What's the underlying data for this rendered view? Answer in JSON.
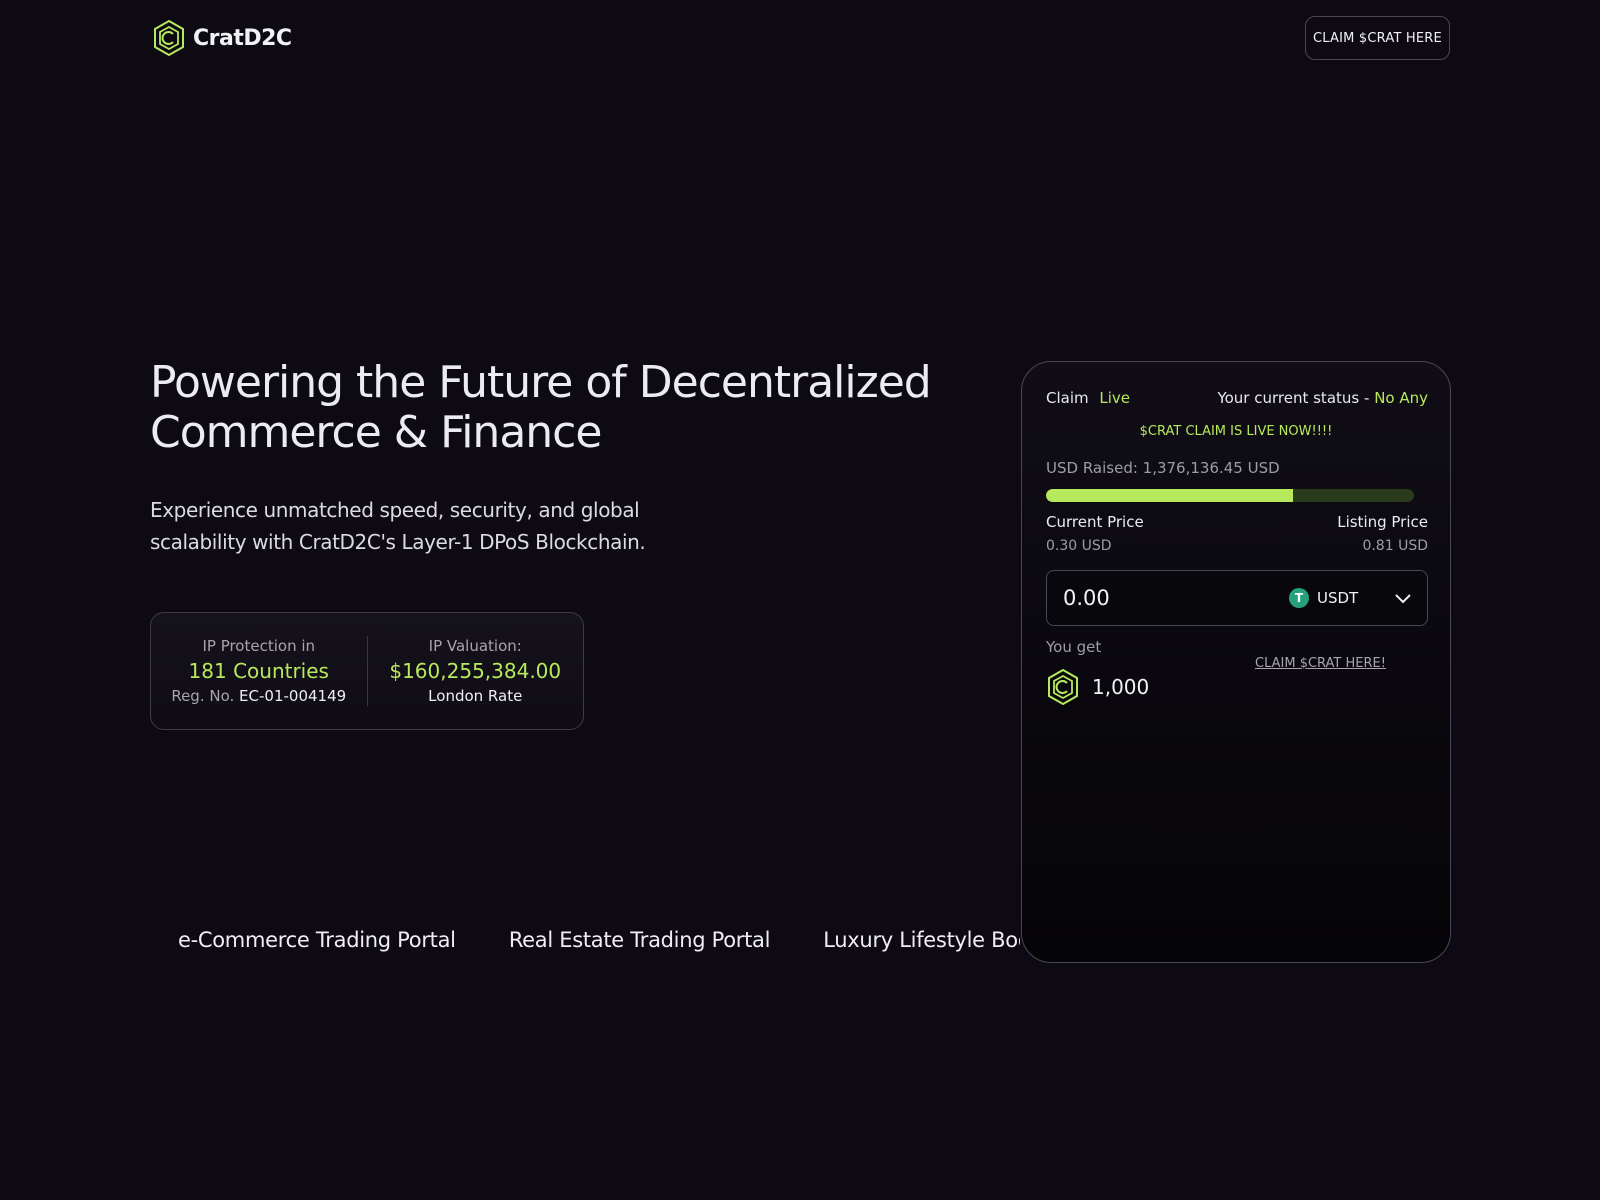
{
  "header": {
    "brand": "CratD2C",
    "claim_button": "CLAIM $CRAT HERE"
  },
  "hero": {
    "title_line1": "Powering the Future of Decentralized",
    "title_line2": "Commerce & Finance",
    "subtitle_line1": "Experience unmatched speed, security, and global",
    "subtitle_line2": "scalability with CratD2C's Layer-1 DPoS Blockchain."
  },
  "ip_card": {
    "protection_label": "IP Protection in",
    "protection_value": "181 Countries",
    "reg_prefix": "Reg. No.",
    "reg_number": "EC-01-004149",
    "valuation_label": "IP Valuation:",
    "valuation_value": "$160,255,384.00",
    "valuation_note": "London Rate"
  },
  "portals": [
    "e-Commerce Trading Portal",
    "Real Estate Trading Portal",
    "Luxury Lifestyle Book"
  ],
  "claim": {
    "label": "Claim",
    "status_live": "Live",
    "current_status_label": "Your current status -",
    "current_status_value": "No Any",
    "banner": "$CRAT CLAIM IS LIVE NOW!!!!",
    "usd_raised": "USD Raised: 1,376,136.45 USD",
    "progress_fraction": 0.67,
    "current_price_label": "Current Price",
    "current_price_value": "0.30 USD",
    "listing_price_label": "Listing Price",
    "listing_price_value": "0.81 USD",
    "amount_value": "0.00",
    "token_label": "USDT",
    "token_icon": "T",
    "you_get_label": "You get",
    "you_get_value": "1,000",
    "claim_link": "CLAIM $CRAT HERE!"
  },
  "colors": {
    "background": "#0e0a14",
    "accent": "#b6ea5c",
    "usdt": "#26a17b"
  }
}
